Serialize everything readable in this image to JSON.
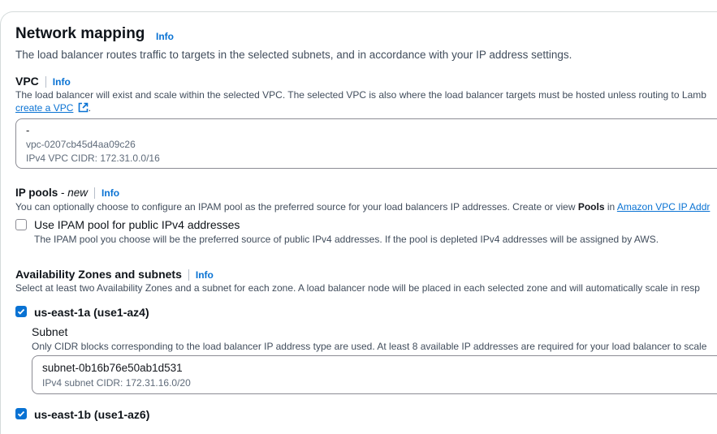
{
  "network_mapping": {
    "title": "Network mapping",
    "info": "Info",
    "description": "The load balancer routes traffic to targets in the selected subnets, and in accordance with your IP address settings."
  },
  "vpc": {
    "label": "VPC",
    "info": "Info",
    "description": "The load balancer will exist and scale within the selected VPC. The selected VPC is also where the load balancer targets must be hosted unless routing to Lamb",
    "create_link": "create a VPC",
    "create_suffix": ".",
    "selected": {
      "name": "-",
      "id": "vpc-0207cb45d4aa09c26",
      "cidr": "IPv4 VPC CIDR: 172.31.0.0/16"
    }
  },
  "ip_pools": {
    "label": "IP pools",
    "label_suffix": " - ",
    "new_tag": "new",
    "info": "Info",
    "description_prefix": "You can optionally choose to configure an IPAM pool as the preferred source for your load balancers IP addresses. Create or view ",
    "description_bold": "Pools",
    "description_mid": " in ",
    "description_link": "Amazon VPC IP Addr",
    "checkbox_label": "Use IPAM pool for public IPv4 addresses",
    "checkbox_checked": false,
    "checkbox_description": "The IPAM pool you choose will be the preferred source of public IPv4 addresses. If the pool is depleted IPv4 addresses will be assigned by AWS."
  },
  "availability_zones": {
    "label": "Availability Zones and subnets",
    "info": "Info",
    "description": "Select at least two Availability Zones and a subnet for each zone. A load balancer node will be placed in each selected zone and will automatically scale in resp",
    "zones": [
      {
        "name": "us-east-1a (use1-az4)",
        "checked": true,
        "subnet_label": "Subnet",
        "subnet_description": "Only CIDR blocks corresponding to the load balancer IP address type are used. At least 8 available IP addresses are required for your load balancer to scale",
        "subnet_id": "subnet-0b16b76e50ab1d531",
        "subnet_cidr": "IPv4 subnet CIDR: 172.31.16.0/20"
      },
      {
        "name": "us-east-1b (use1-az6)",
        "checked": true
      }
    ]
  },
  "colors": {
    "link": "#0972d3",
    "checkbox_checked": "#0972d3",
    "heading": "#0f141a",
    "description": "#414d5c"
  }
}
